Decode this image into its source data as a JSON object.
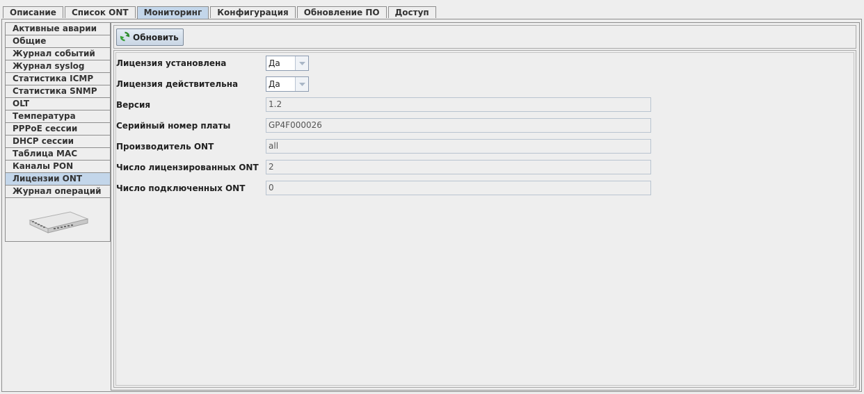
{
  "top_tabs": [
    {
      "label": "Описание"
    },
    {
      "label": "Список ONT"
    },
    {
      "label": "Мониторинг",
      "active": true
    },
    {
      "label": "Конфигурация"
    },
    {
      "label": "Обновление ПО"
    },
    {
      "label": "Доступ"
    }
  ],
  "side_tabs": [
    {
      "label": "Активные аварии"
    },
    {
      "label": "Общие"
    },
    {
      "label": "Журнал событий"
    },
    {
      "label": "Журнал syslog"
    },
    {
      "label": "Статистика ICMP"
    },
    {
      "label": "Статистика SNMP"
    },
    {
      "label": "OLT"
    },
    {
      "label": "Температура"
    },
    {
      "label": "PPPoE сессии"
    },
    {
      "label": "DHCP сессии"
    },
    {
      "label": "Таблица MAC"
    },
    {
      "label": "Каналы PON"
    },
    {
      "label": "Лицензии ONT",
      "active": true
    },
    {
      "label": "Журнал операций"
    }
  ],
  "toolbar": {
    "refresh_label": "Обновить",
    "refresh_icon": "refresh-icon"
  },
  "form": {
    "license_installed": {
      "label": "Лицензия установлена",
      "value": "Да"
    },
    "license_valid": {
      "label": "Лицензия действительна",
      "value": "Да"
    },
    "version": {
      "label": "Версия",
      "value": "1.2"
    },
    "board_serial": {
      "label": "Серийный номер платы",
      "value": "GP4F000026"
    },
    "ont_vendor": {
      "label": "Производитель ONT",
      "value": "all"
    },
    "licensed_ont_count": {
      "label": "Число лицензированных ONT",
      "value": "2"
    },
    "connected_ont_count": {
      "label": "Число подключенных ONT",
      "value": "0"
    }
  },
  "colors": {
    "active_tab": "#c3d6ea",
    "background": "#eeeeee",
    "border": "#8d8d8d"
  }
}
